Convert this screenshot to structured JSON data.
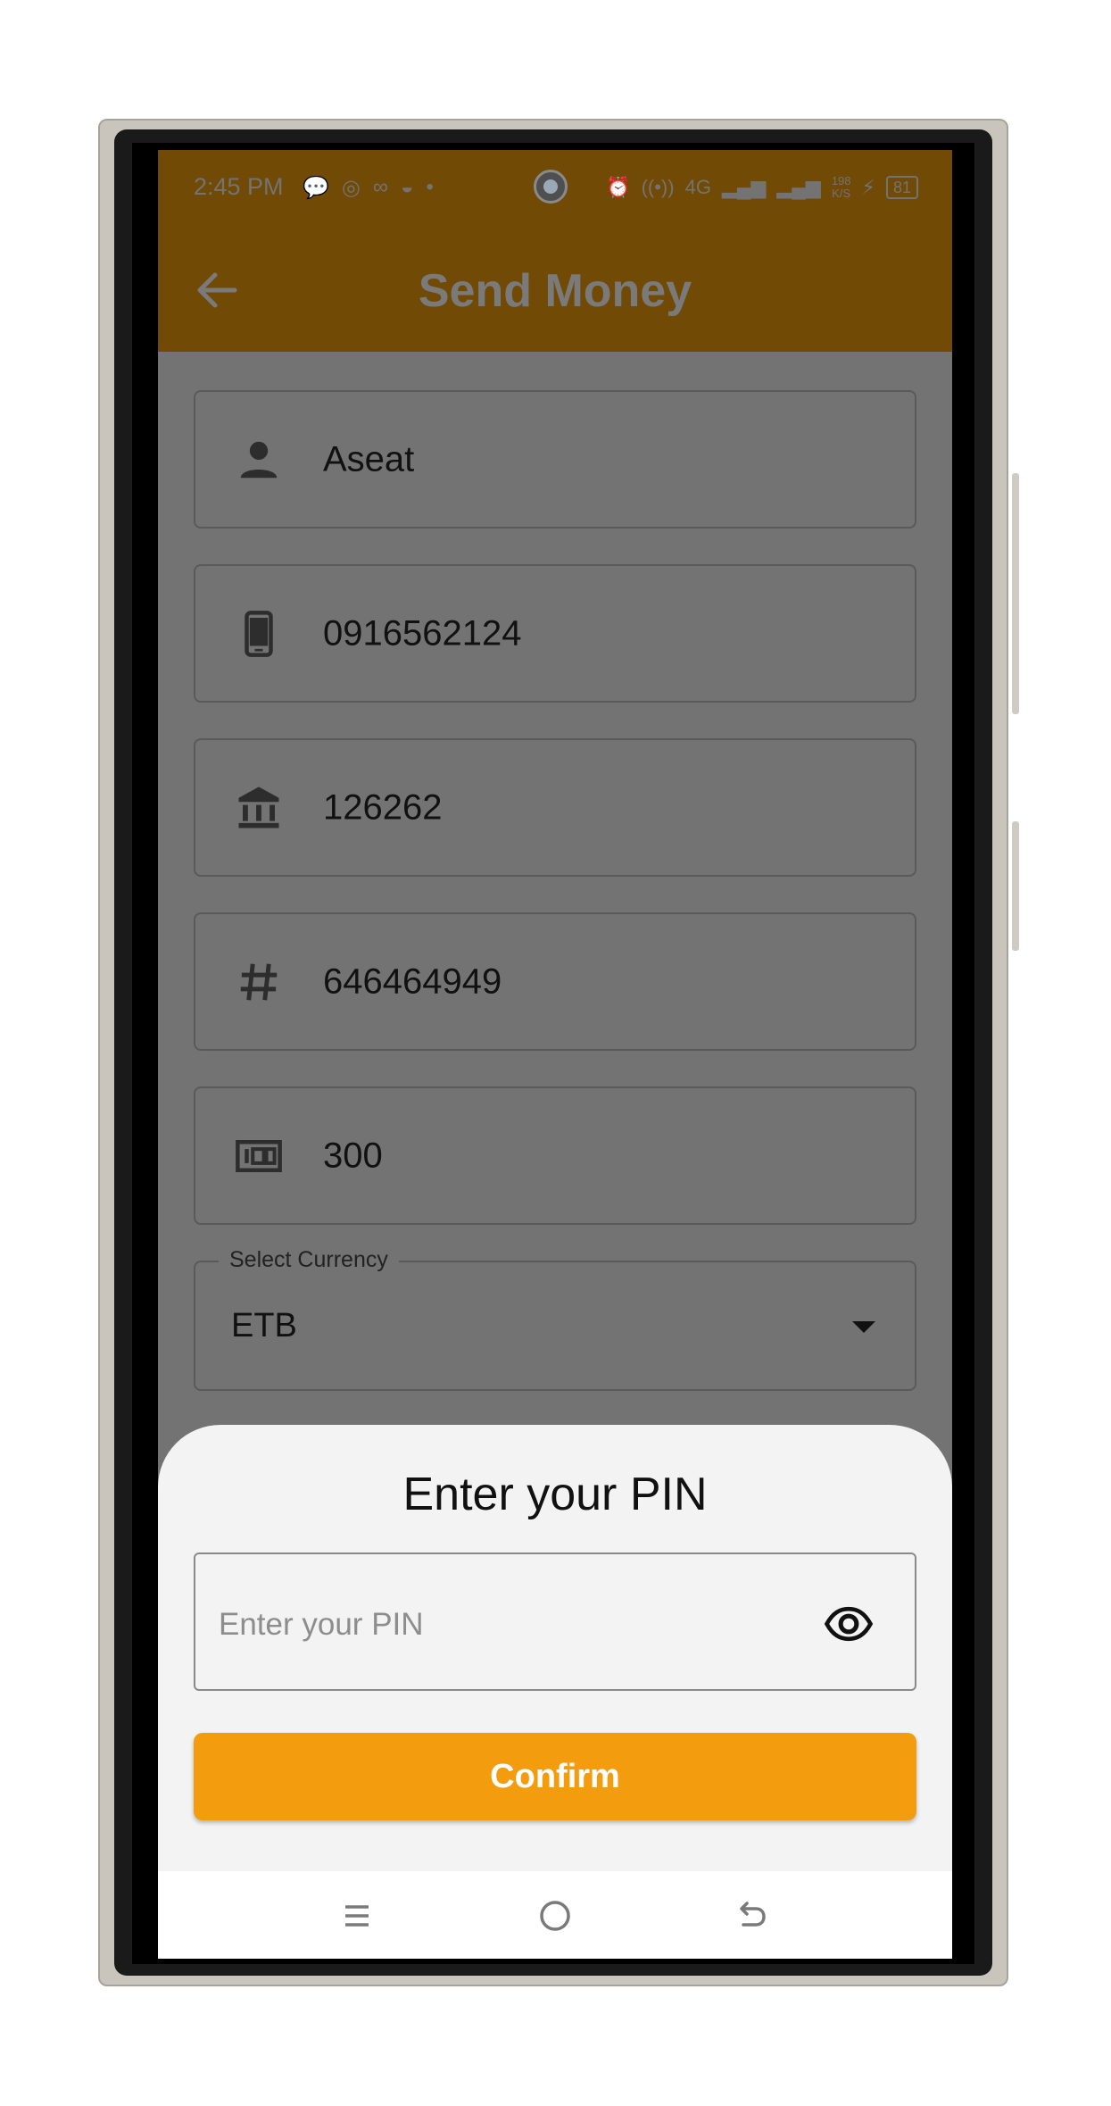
{
  "status_bar": {
    "time": "2:45 PM",
    "left_icons": [
      "chat-bubble-icon",
      "messenger-icon",
      "glasses-icon",
      "bowl-icon",
      "dot-icon"
    ],
    "network_type": "4G",
    "speed_value": "198",
    "speed_unit": "K/S",
    "battery": "81"
  },
  "app_bar": {
    "title": "Send Money",
    "back_icon": "arrow-left-icon",
    "background": "#714a06"
  },
  "form": {
    "fields": [
      {
        "icon": "person-icon",
        "value": "Aseat"
      },
      {
        "icon": "phone-icon",
        "value": "0916562124"
      },
      {
        "icon": "bank-icon",
        "value": "126262"
      },
      {
        "icon": "hash-icon",
        "value": "646464949"
      },
      {
        "icon": "money-icon",
        "value": "300"
      }
    ],
    "currency": {
      "label": "Select Currency",
      "value": "ETB"
    }
  },
  "pin_sheet": {
    "title": "Enter your PIN",
    "placeholder": "Enter your PIN",
    "value": "",
    "confirm_label": "Confirm",
    "accent": "#f29c0e"
  },
  "nav_bar": {
    "buttons": [
      "recents-icon",
      "home-icon",
      "back-icon"
    ]
  }
}
